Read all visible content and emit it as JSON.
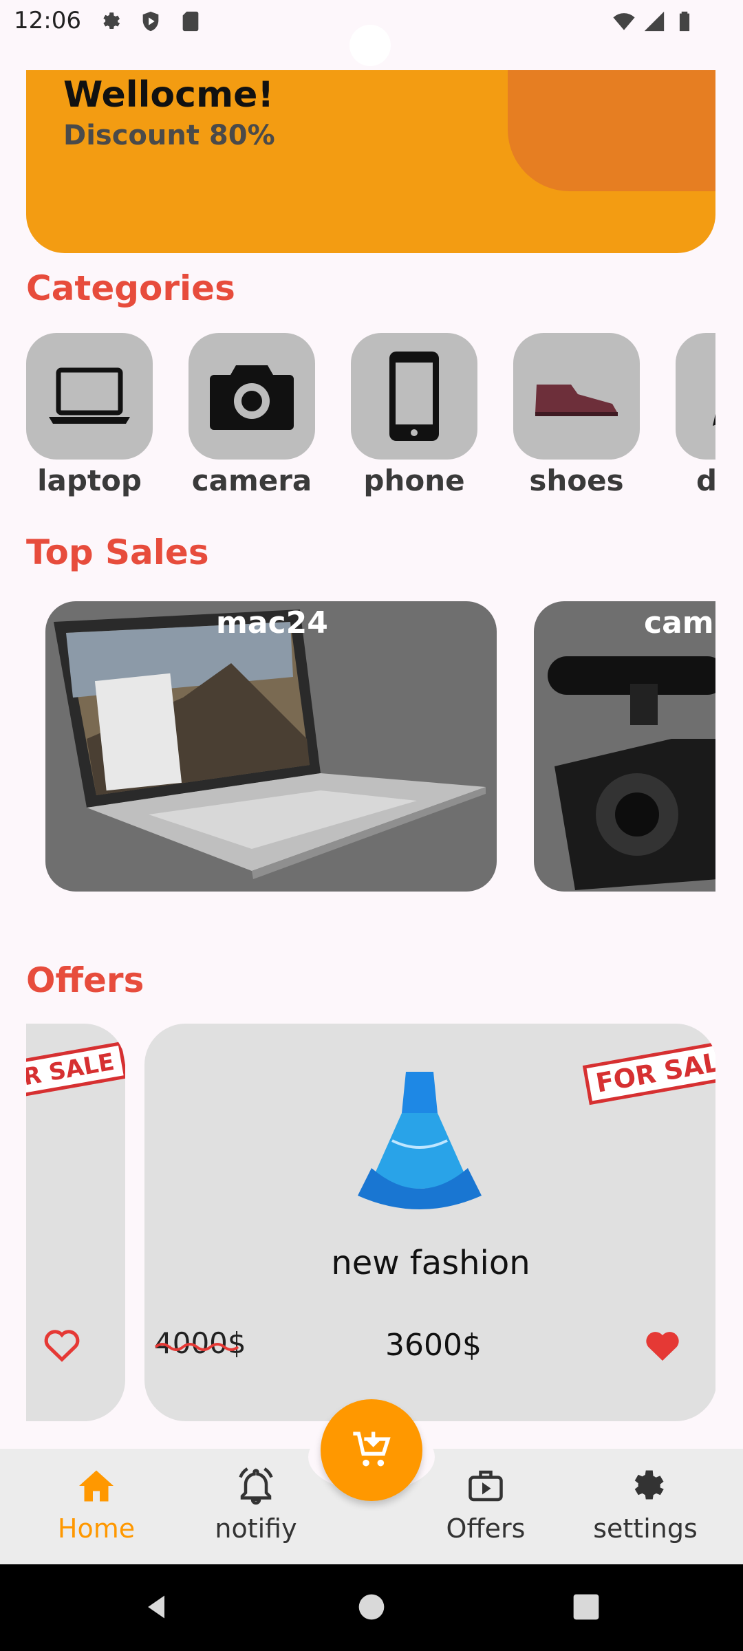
{
  "status_bar": {
    "time": "12:06"
  },
  "banner": {
    "title": "Wellocme!",
    "subtitle": "Discount 80%"
  },
  "sections": {
    "categories": "Categories",
    "top_sales": "Top Sales",
    "offers": "Offers"
  },
  "categories": [
    {
      "label": "laptop",
      "icon": "laptop-icon"
    },
    {
      "label": "camera",
      "icon": "camera-icon"
    },
    {
      "label": "phone",
      "icon": "phone-icon"
    },
    {
      "label": "shoes",
      "icon": "shoe-icon"
    },
    {
      "label": "d",
      "icon": "partial-icon"
    }
  ],
  "top_sales": [
    {
      "label": "mac24"
    },
    {
      "label": "cam"
    }
  ],
  "offers": {
    "stamp_text": "FOR SALE",
    "stamp_partial": "R SALE",
    "item": {
      "name": "new fashion",
      "old_price": "4000$",
      "new_price": "3600$",
      "favorited": true
    },
    "prev_item": {
      "favorited": false
    }
  },
  "bottom_nav": {
    "items": [
      {
        "label": "Home",
        "icon": "home-icon",
        "active": true
      },
      {
        "label": "notifiy",
        "icon": "bell-icon",
        "active": false
      },
      {
        "label": "Offers",
        "icon": "offers-icon",
        "active": false
      },
      {
        "label": "settings",
        "icon": "settings-icon",
        "active": false
      }
    ]
  },
  "colors": {
    "accent": "#ff9800",
    "section_title": "#e74c3c",
    "heart": "#e53935"
  }
}
